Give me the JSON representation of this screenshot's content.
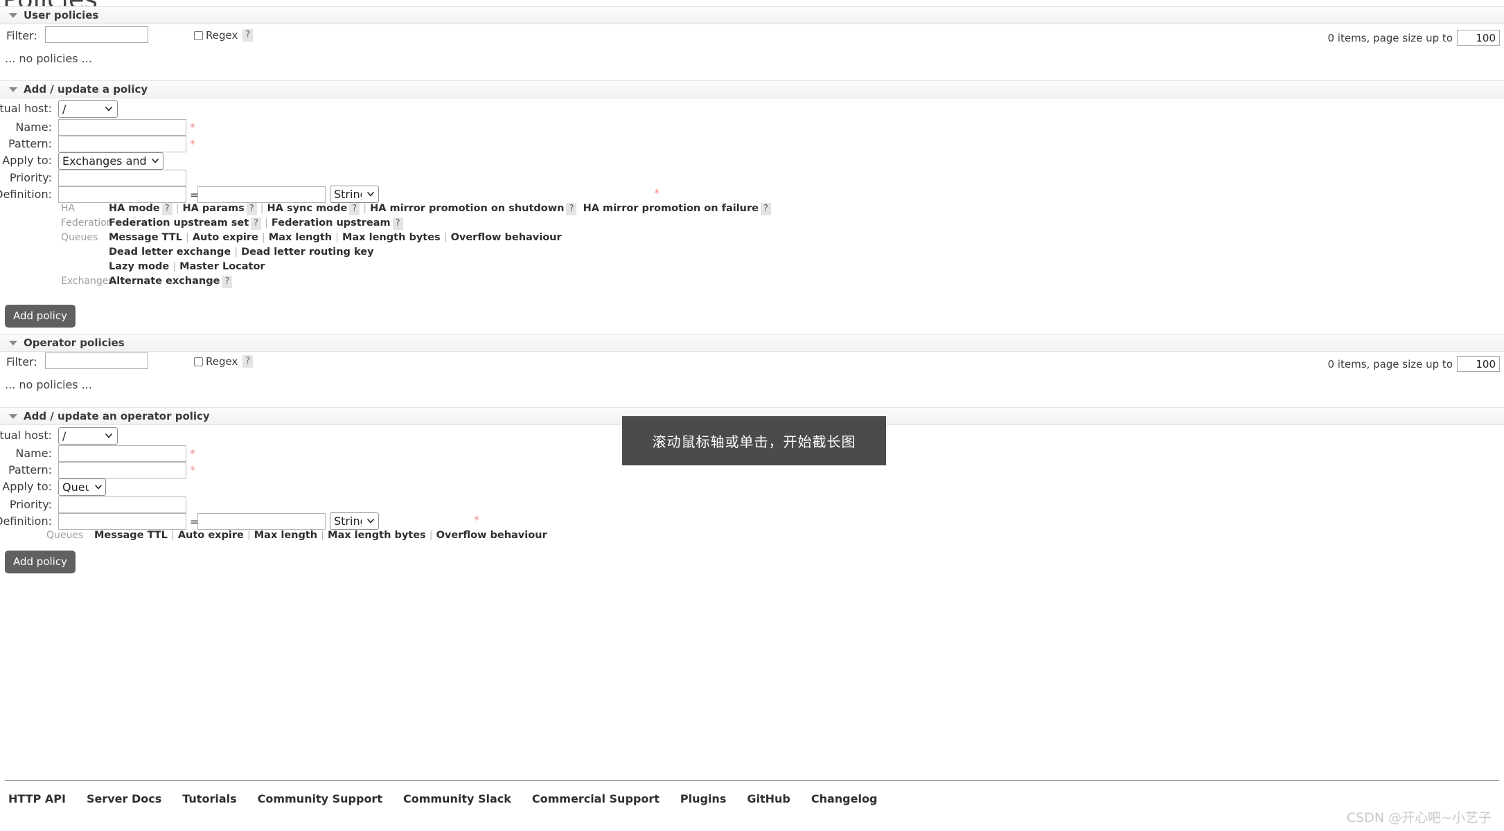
{
  "page": {
    "title": "Policies"
  },
  "user_policies": {
    "section_title": "User policies",
    "filter_label": "Filter:",
    "filter_value": "",
    "regex_label": "Regex",
    "help_glyph": "?",
    "pager_text": "0 items, page size up to",
    "page_size": "100",
    "empty_text": "... no policies ..."
  },
  "add_policy": {
    "section_title": "Add / update a policy",
    "fields": {
      "vhost_label": "Virtual host:",
      "vhost_value": "/",
      "name_label": "Name:",
      "name_value": "",
      "pattern_label": "Pattern:",
      "pattern_value": "",
      "applyto_label": "Apply to:",
      "applyto_value": "Exchanges and queues",
      "priority_label": "Priority:",
      "priority_value": "",
      "definition_label": "Definition:",
      "definition_key": "",
      "definition_value": "",
      "definition_type": "String",
      "equals": "=",
      "required_mark": "*"
    },
    "hints": [
      {
        "group": "HA",
        "links": [
          {
            "label": "HA mode",
            "help": true,
            "sep": true
          },
          {
            "label": "HA params",
            "help": true,
            "sep": true
          },
          {
            "label": "HA sync mode",
            "help": true,
            "sep": true
          },
          {
            "label": "HA mirror promotion on shutdown",
            "help": true,
            "sep": false
          },
          {
            "label": "HA mirror promotion on failure",
            "help": true,
            "sep": false
          }
        ]
      },
      {
        "group": "Federation",
        "links": [
          {
            "label": "Federation upstream set",
            "help": true,
            "sep": true
          },
          {
            "label": "Federation upstream",
            "help": true,
            "sep": false
          }
        ]
      },
      {
        "group": "Queues",
        "links": [
          {
            "label": "Message TTL",
            "help": false,
            "sep": true
          },
          {
            "label": "Auto expire",
            "help": false,
            "sep": true
          },
          {
            "label": "Max length",
            "help": false,
            "sep": true
          },
          {
            "label": "Max length bytes",
            "help": false,
            "sep": true
          },
          {
            "label": "Overflow behaviour",
            "help": false,
            "sep": false
          }
        ]
      },
      {
        "group": "",
        "links": [
          {
            "label": "Dead letter exchange",
            "help": false,
            "sep": true
          },
          {
            "label": "Dead letter routing key",
            "help": false,
            "sep": false
          }
        ]
      },
      {
        "group": "",
        "links": [
          {
            "label": "Lazy mode",
            "help": false,
            "sep": true
          },
          {
            "label": "Master Locator",
            "help": false,
            "sep": false
          }
        ]
      },
      {
        "group": "Exchanges",
        "links": [
          {
            "label": "Alternate exchange",
            "help": true,
            "sep": false
          }
        ]
      }
    ],
    "submit_label": "Add policy"
  },
  "operator_policies": {
    "section_title": "Operator policies",
    "filter_label": "Filter:",
    "filter_value": "",
    "regex_label": "Regex",
    "help_glyph": "?",
    "pager_text": "0 items, page size up to",
    "page_size": "100",
    "empty_text": "... no policies ..."
  },
  "add_operator_policy": {
    "section_title": "Add / update an operator policy",
    "fields": {
      "vhost_label": "Virtual host:",
      "vhost_value": "/",
      "name_label": "Name:",
      "name_value": "",
      "pattern_label": "Pattern:",
      "pattern_value": "",
      "applyto_label": "Apply to:",
      "applyto_value": "Queues",
      "priority_label": "Priority:",
      "priority_value": "",
      "definition_label": "Definition:",
      "definition_key": "",
      "definition_value": "",
      "definition_type": "String",
      "equals": "=",
      "required_mark": "*"
    },
    "hints": [
      {
        "group": "Queues",
        "links": [
          {
            "label": "Message TTL",
            "help": false,
            "sep": true
          },
          {
            "label": "Auto expire",
            "help": false,
            "sep": true
          },
          {
            "label": "Max length",
            "help": false,
            "sep": true
          },
          {
            "label": "Max length bytes",
            "help": false,
            "sep": true
          },
          {
            "label": "Overflow behaviour",
            "help": false,
            "sep": false
          }
        ]
      }
    ],
    "submit_label": "Add policy"
  },
  "footer": {
    "links": [
      "HTTP API",
      "Server Docs",
      "Tutorials",
      "Community Support",
      "Community Slack",
      "Commercial Support",
      "Plugins",
      "GitHub",
      "Changelog"
    ]
  },
  "overlay": {
    "screenshot_tip": "滚动鼠标轴或单击，开始截长图"
  },
  "watermark": {
    "text": "CSDN @开心吧~小艺子"
  },
  "colors": {
    "button_bg": "#606060",
    "required": "#f48a8a",
    "section_bg": "#f4f4f4",
    "tooltip_bg": "#4b4b4b"
  }
}
